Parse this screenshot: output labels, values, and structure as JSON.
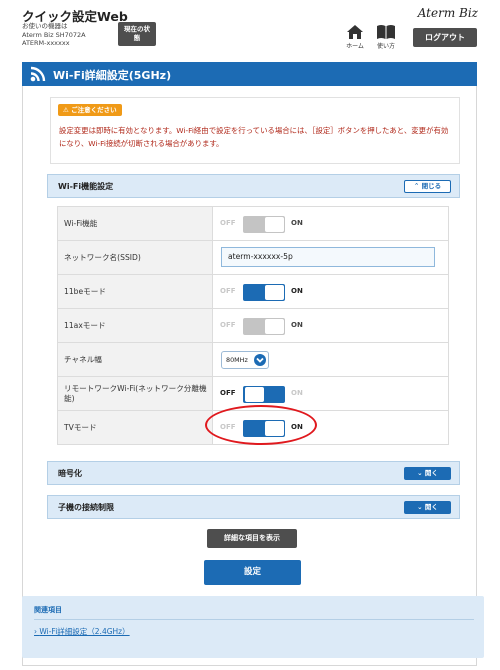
{
  "header": {
    "app_title": "クイック設定Web",
    "device_label": "お使いの機器は",
    "device_model": "Aterm Biz SH7072A",
    "device_name": "ATERM-xxxxxx",
    "status_button": "現在の状態",
    "brand": "Aterm Biz",
    "home_label": "ホーム",
    "help_label": "使い方",
    "logout_button": "ログアウト"
  },
  "page": {
    "title": "Wi-Fi詳細設定(5GHz)"
  },
  "notice": {
    "badge": "ご注意ください",
    "text": "設定変更は即時に有効となります。Wi-Fi経由で設定を行っている場合には、［設定］ボタンを押したあと、変更が有効になり、Wi-Fi接続が切断される場合があります。"
  },
  "sections": {
    "wifi_function": {
      "title": "Wi-Fi機能設定",
      "toggle": "閉じる"
    },
    "encryption": {
      "title": "暗号化",
      "toggle": "開く"
    },
    "access_limit": {
      "title": "子機の接続制限",
      "toggle": "開く"
    }
  },
  "settings": {
    "wifi": {
      "label": "Wi-Fi機能",
      "off": "OFF",
      "on": "ON",
      "state": "on-disabled"
    },
    "ssid": {
      "label": "ネットワーク名(SSID)",
      "value": "aterm-xxxxxx-5p"
    },
    "be_mode": {
      "label": "11beモード",
      "off": "OFF",
      "on": "ON",
      "state": "on"
    },
    "ax_mode": {
      "label": "11axモード",
      "off": "OFF",
      "on": "ON",
      "state": "on-disabled"
    },
    "channel_width": {
      "label": "チャネル幅",
      "value": "80MHz"
    },
    "remote_wifi": {
      "label": "リモートワークWi-Fi(ネットワーク分離機能)",
      "off": "OFF",
      "on": "ON",
      "state": "off"
    },
    "tv_mode": {
      "label": "TVモード",
      "off": "OFF",
      "on": "ON",
      "state": "on"
    }
  },
  "buttons": {
    "show_details": "詳細な項目を表示",
    "apply": "設定"
  },
  "related": {
    "title": "関連項目",
    "link": "Wi-Fi詳細設定（2.4GHz）"
  },
  "colors": {
    "primary": "#1c6bb4",
    "dark_button": "#4e4e4e",
    "warning_badge": "#f09a17",
    "notice_text": "#b0281a",
    "highlight_circle": "#e0191e"
  }
}
